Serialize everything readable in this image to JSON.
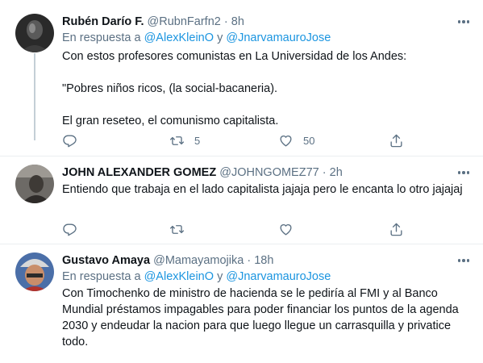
{
  "tweets": [
    {
      "name": "Rubén Darío F.",
      "handle": "@RubnFarfn2",
      "dot": "·",
      "time": "8h",
      "reply_prefix": "En respuesta a",
      "reply_users": [
        "@AlexKleinO",
        "@JnarvamauroJose"
      ],
      "reply_joiner": "y",
      "lines": [
        "Con estos profesores comunistas en La Universidad de los Andes:",
        "\"Pobres niños ricos, (la social-bacaneria).",
        "El gran reseteo, el comunismo capitalista."
      ],
      "retweets": "5",
      "likes": "50"
    },
    {
      "name": "JOHN ALEXANDER GOMEZ",
      "handle": "@JOHNGOMEZ77",
      "dot": "·",
      "time": "2h",
      "lines": [
        "Entiendo que trabaja en el lado capitalista jajaja pero le encanta lo otro jajajaj"
      ],
      "retweets": "",
      "likes": ""
    },
    {
      "name": "Gustavo Amaya",
      "handle": "@Mamayamojika",
      "dot": "·",
      "time": "18h",
      "reply_prefix": "En respuesta a",
      "reply_users": [
        "@AlexKleinO",
        "@JnarvamauroJose"
      ],
      "reply_joiner": "y",
      "lines": [
        "Con Timochenko de ministro de hacienda  se le pediría al FMI y al Banco Mundial préstamos impagables para poder financiar los puntos de la agenda 2030 y endeudar la nacion para que luego llegue un carrasquilla y privatice todo."
      ]
    }
  ],
  "icons": {
    "reply": "reply-icon",
    "retweet": "retweet-icon",
    "like": "heart-icon",
    "share": "share-icon",
    "more": "more-icon"
  },
  "colors": {
    "link": "#1b95e0",
    "secondary": "#5b7083",
    "text": "#0f1419",
    "separator": "#ebeef0"
  }
}
